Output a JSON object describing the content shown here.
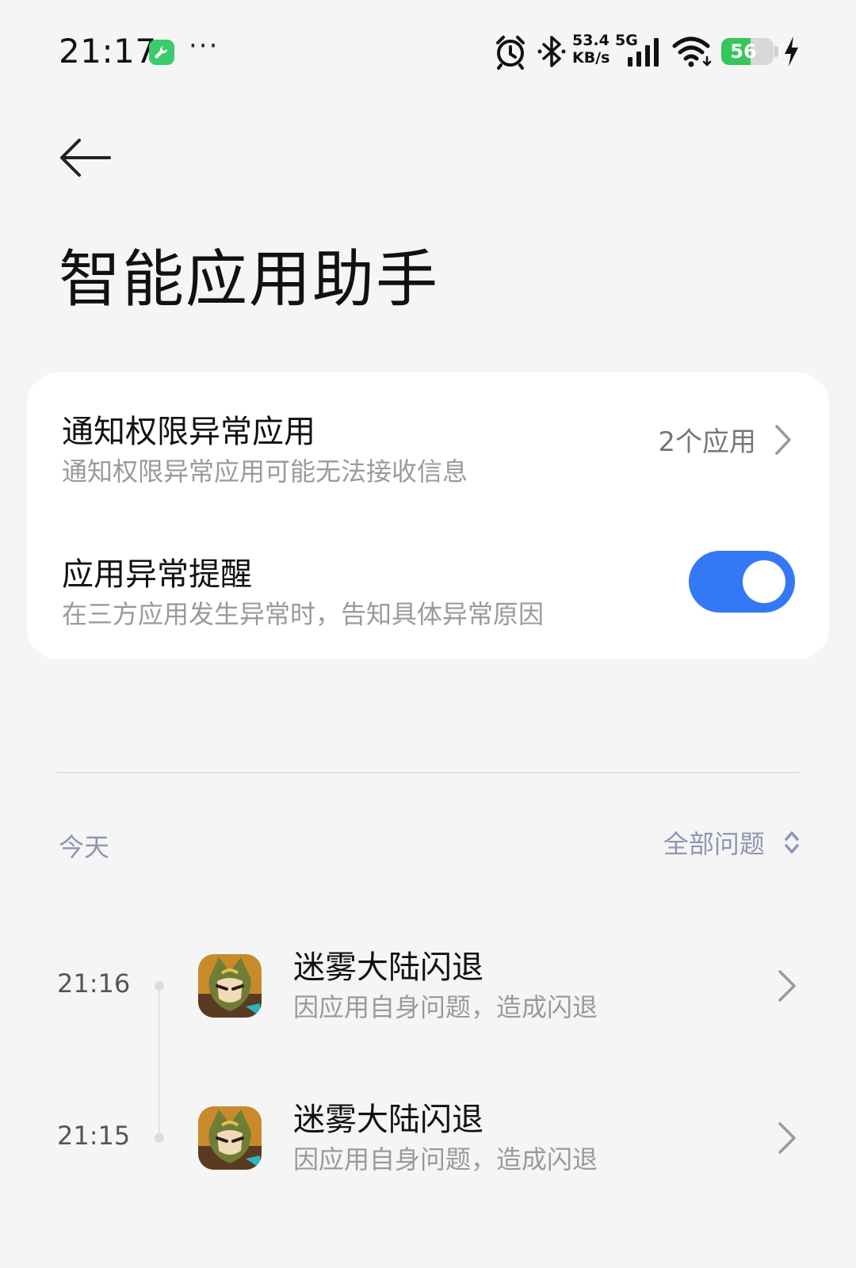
{
  "status_bar": {
    "time": "21:17",
    "more": "···",
    "net_speed_value": "53.4",
    "net_speed_unit": "KB/s",
    "net_type": "5G",
    "battery_level": "56",
    "battery_fraction": 0.56,
    "icons": [
      "app-notification-icon",
      "alarm-icon",
      "bluetooth-icon",
      "signal-icon",
      "wifi-icon",
      "battery-icon",
      "charging-icon"
    ]
  },
  "header": {
    "back_icon": "back-arrow-icon",
    "title": "智能应用助手"
  },
  "settings": {
    "notification_permission": {
      "title": "通知权限异常应用",
      "subtitle": "通知权限异常应用可能无法接收信息",
      "value": "2个应用"
    },
    "anomaly_alert": {
      "title": "应用异常提醒",
      "subtitle": "在三方应用发生异常时，告知具体异常原因",
      "enabled": true
    }
  },
  "section": {
    "label": "今天",
    "filter_label": "全部问题"
  },
  "events": [
    {
      "time": "21:16",
      "title": "迷雾大陆闪退",
      "subtitle": "因应用自身问题，造成闪退"
    },
    {
      "time": "21:15",
      "title": "迷雾大陆闪退",
      "subtitle": "因应用自身问题，造成闪退"
    }
  ],
  "colors": {
    "background": "#f5f5f5",
    "card": "#ffffff",
    "accent": "#3478f6",
    "battery": "#35c759",
    "muted_label": "#8d96b3",
    "secondary_text": "#9a9a9a"
  }
}
